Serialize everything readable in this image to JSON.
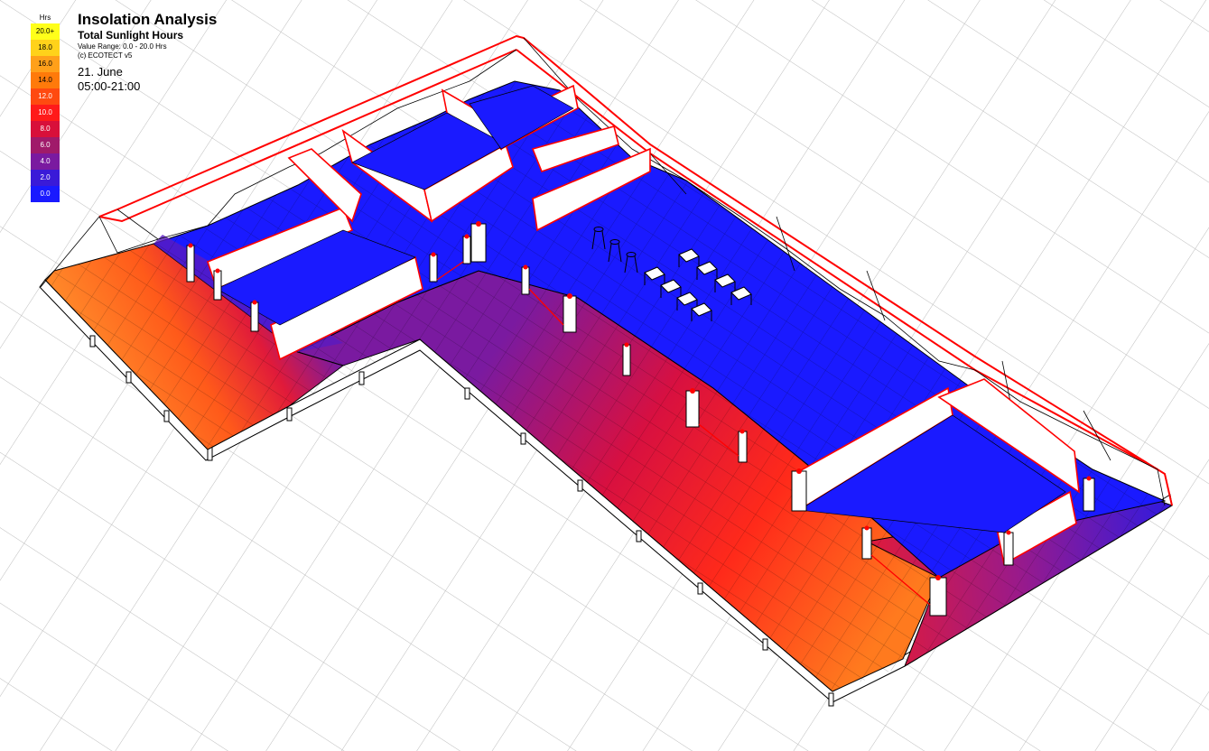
{
  "legend": {
    "unit": "Hrs",
    "items": [
      {
        "label": "20.0+",
        "color": "#ffff1a",
        "dark_text": true
      },
      {
        "label": "18.0",
        "color": "#ffd21a",
        "dark_text": true
      },
      {
        "label": "16.0",
        "color": "#ffa01a",
        "dark_text": true
      },
      {
        "label": "14.0",
        "color": "#ff7a0a",
        "dark_text": true
      },
      {
        "label": "12.0",
        "color": "#ff4a10",
        "dark_text": false
      },
      {
        "label": "10.0",
        "color": "#ff1a1a",
        "dark_text": false
      },
      {
        "label": "8.0",
        "color": "#d8103a",
        "dark_text": false
      },
      {
        "label": "6.0",
        "color": "#a01a6a",
        "dark_text": false
      },
      {
        "label": "4.0",
        "color": "#7a1aa0",
        "dark_text": false
      },
      {
        "label": "2.0",
        "color": "#3a1ad8",
        "dark_text": false
      },
      {
        "label": "0.0",
        "color": "#1a1aff",
        "dark_text": false
      }
    ]
  },
  "header": {
    "title": "Insolation Analysis",
    "subtitle": "Total Sunlight Hours",
    "range": "Value Range: 0.0 - 20.0 Hrs",
    "copyright": "(c) ECOTECT v5",
    "date": "21. June",
    "time": "05:00-21:00"
  },
  "colors": {
    "cold": "#1a1aff",
    "warm": "#ff2a1a",
    "hot": "#ff8a1e",
    "wall_edge": "#ff0000",
    "grid": "#b8b8b8"
  }
}
